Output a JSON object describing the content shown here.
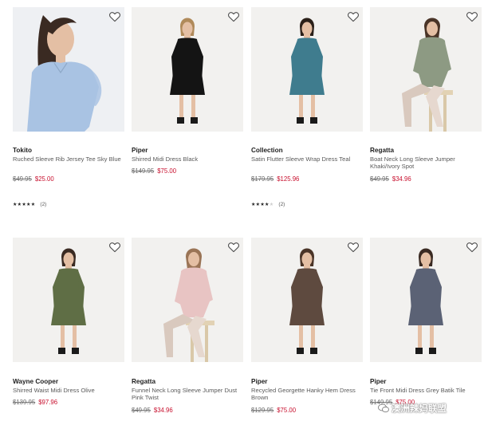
{
  "products": [
    {
      "brand": "Tokito",
      "name": "Ruched Sleeve Rib Jersey Tee Sky Blue",
      "was": "$49.95",
      "now": "$25.00",
      "stars": 5,
      "reviews": "(2)",
      "colors": {
        "bg": "#eef0f3",
        "garment": "#a9c3e3",
        "hair": "#3a2a22"
      }
    },
    {
      "brand": "Piper",
      "name": "Shirred Midi Dress Black",
      "was": "$149.95",
      "now": "$75.00",
      "stars": null,
      "reviews": "",
      "colors": {
        "bg": "#f2f1ef",
        "garment": "#141414",
        "hair": "#b08a5a"
      }
    },
    {
      "brand": "Collection",
      "name": "Satin Flutter Sleeve Wrap Dress Teal",
      "was": "$179.95",
      "now": "$125.96",
      "stars": 4,
      "reviews": "(2)",
      "colors": {
        "bg": "#f2f1ef",
        "garment": "#3f7c8e",
        "hair": "#2b2019"
      }
    },
    {
      "brand": "Regatta",
      "name": "Boat Neck Long Sleeve Jumper Khaki/Ivory Spot",
      "was": "$49.95",
      "now": "$34.96",
      "stars": null,
      "reviews": "",
      "colors": {
        "bg": "#f2f1ef",
        "garment": "#8d9a83",
        "hair": "#4a3427"
      }
    },
    {
      "brand": "Wayne Cooper",
      "name": "Shirred Waist Midi Dress Olive",
      "was": "$139.95",
      "now": "$97.96",
      "stars": null,
      "reviews": "",
      "colors": {
        "bg": "#f2f1ef",
        "garment": "#5f6e45",
        "hair": "#3a2a22"
      }
    },
    {
      "brand": "Regatta",
      "name": "Funnel Neck Long Sleeve Jumper Dust Pink Twist",
      "was": "$49.95",
      "now": "$34.96",
      "stars": null,
      "reviews": "",
      "colors": {
        "bg": "#f2f1ef",
        "garment": "#e8c4c3",
        "hair": "#9a7456"
      }
    },
    {
      "brand": "Piper",
      "name": "Recycled Georgette Hanky Hem Dress Brown",
      "was": "$129.95",
      "now": "$75.00",
      "stars": null,
      "reviews": "",
      "colors": {
        "bg": "#f2f1ef",
        "garment": "#5e4a3f",
        "hair": "#4a3427"
      }
    },
    {
      "brand": "Piper",
      "name": "Tie Front Midi Dress Grey Batik Tile",
      "was": "$149.95",
      "now": "$75.00",
      "stars": null,
      "reviews": "",
      "colors": {
        "bg": "#f2f1ef",
        "garment": "#5b6275",
        "hair": "#3a2a22"
      }
    }
  ],
  "watermark": "澳洲辣妈联盟",
  "icons": {
    "wishlist": "heart-outline-icon",
    "star": "star-icon",
    "watermark": "wechat-icon"
  }
}
